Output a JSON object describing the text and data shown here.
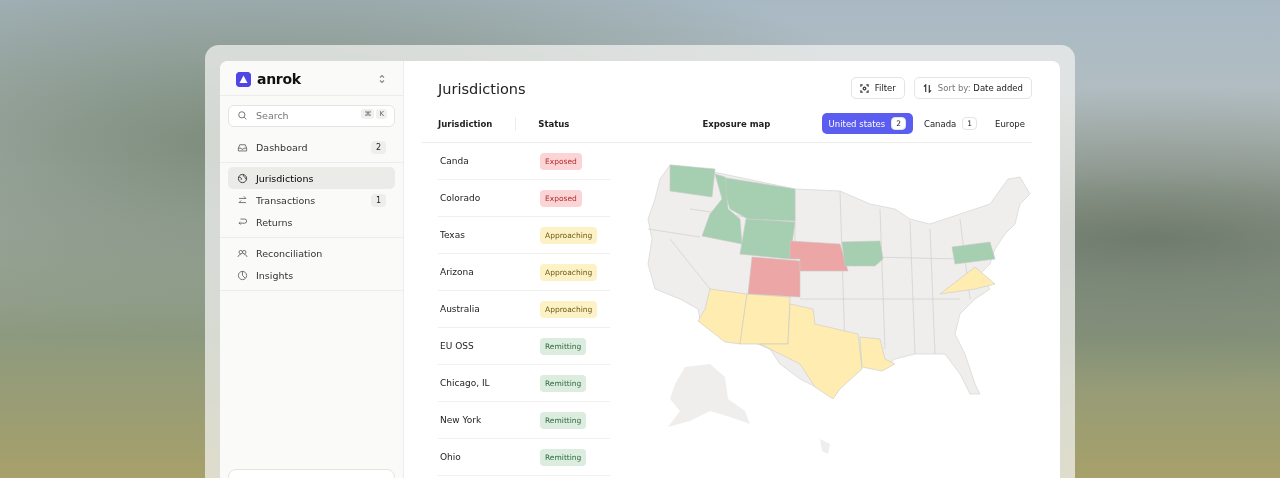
{
  "sidebar": {
    "brand": "anrok",
    "search": {
      "placeholder": "Search",
      "shortcut": [
        "⌘",
        "K"
      ]
    },
    "sections": [
      {
        "items": [
          {
            "label": "Dashboard",
            "badge": "2",
            "selected": false
          }
        ]
      },
      {
        "items": [
          {
            "label": "Jurisdictions",
            "selected": true
          },
          {
            "label": "Transactions",
            "badge": "1",
            "selected": false
          },
          {
            "label": "Returns",
            "selected": false
          }
        ]
      },
      {
        "items": [
          {
            "label": "Reconciliation",
            "selected": false
          },
          {
            "label": "Insights",
            "selected": false
          }
        ]
      }
    ]
  },
  "main": {
    "title": "Jurisdictions",
    "filter_button": "Filter",
    "sort_button": {
      "prefix": "Sort by:",
      "value": "Date added"
    },
    "columns": [
      "Jurisdiction",
      "Status"
    ],
    "map_label": "Exposure map",
    "region_tabs": [
      {
        "label": "United states",
        "count": "2",
        "selected": true
      },
      {
        "label": "Canada",
        "count": "1",
        "selected": false
      },
      {
        "label": "Europe",
        "selected": false
      }
    ],
    "rows": [
      {
        "jurisdiction": "Canda",
        "status": "Exposed",
        "kind": "exposed"
      },
      {
        "jurisdiction": "Colorado",
        "status": "Exposed",
        "kind": "exposed"
      },
      {
        "jurisdiction": "Texas",
        "status": "Approaching",
        "kind": "approaching"
      },
      {
        "jurisdiction": "Arizona",
        "status": "Approaching",
        "kind": "approaching"
      },
      {
        "jurisdiction": "Australia",
        "status": "Approaching",
        "kind": "approaching"
      },
      {
        "jurisdiction": "EU OSS",
        "status": "Remitting",
        "kind": "remitting"
      },
      {
        "jurisdiction": "Chicago, IL",
        "status": "Remitting",
        "kind": "remitting"
      },
      {
        "jurisdiction": "New York",
        "status": "Remitting",
        "kind": "remitting"
      },
      {
        "jurisdiction": "Ohio",
        "status": "Remitting",
        "kind": "remitting"
      }
    ]
  }
}
